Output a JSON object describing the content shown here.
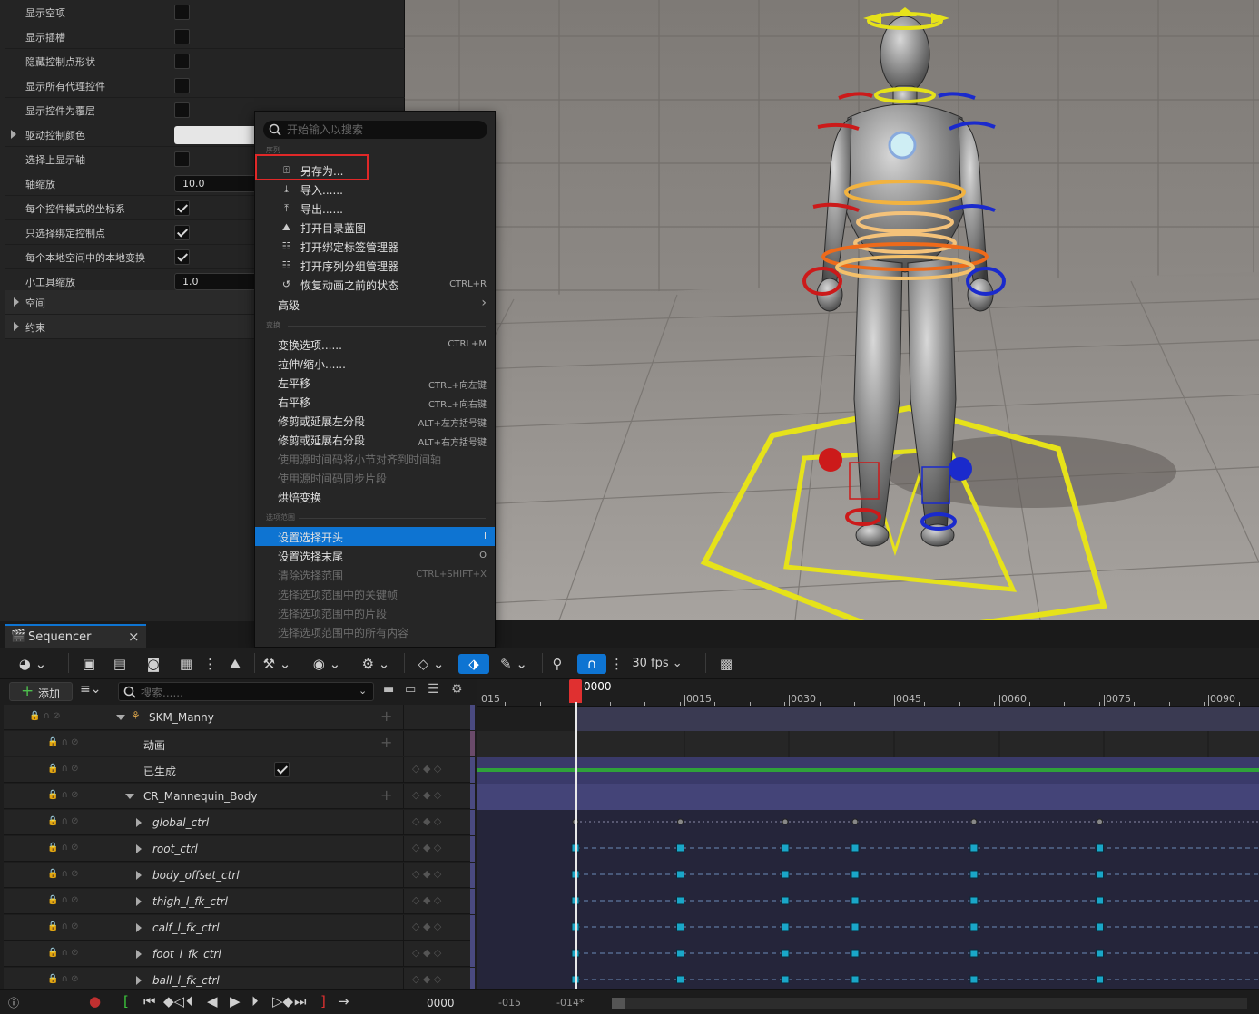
{
  "details": {
    "rows": [
      {
        "label": "显示空项",
        "type": "checkbox",
        "checked": false
      },
      {
        "label": "显示插槽",
        "type": "checkbox",
        "checked": false
      },
      {
        "label": "隐藏控制点形状",
        "type": "checkbox",
        "checked": false
      },
      {
        "label": "显示所有代理控件",
        "type": "checkbox",
        "checked": false
      },
      {
        "label": "显示控件为覆层",
        "type": "checkbox",
        "checked": false
      },
      {
        "label": "驱动控制颜色",
        "type": "color",
        "expandable": true
      },
      {
        "label": "选择上显示轴",
        "type": "checkbox",
        "checked": false
      },
      {
        "label": "轴缩放",
        "type": "number",
        "value": "10.0"
      },
      {
        "label": "每个控件模式的坐标系",
        "type": "checkbox",
        "checked": true
      },
      {
        "label": "只选择绑定控制点",
        "type": "checkbox",
        "checked": true
      },
      {
        "label": "每个本地空间中的本地变换",
        "type": "checkbox",
        "checked": true
      },
      {
        "label": "小工具缩放",
        "type": "number",
        "value": "1.0"
      }
    ],
    "categories": [
      "空间",
      "约束"
    ]
  },
  "menu": {
    "search_placeholder": "开始输入以搜索",
    "sections": {
      "sequence": "序列",
      "transform": "变换",
      "selection_range": "选项范围"
    },
    "items": [
      {
        "label": "另存为...",
        "shortcut": "",
        "icon": "save-as-icon",
        "highlighted_box": true
      },
      {
        "label": "导入......",
        "shortcut": "",
        "icon": "import-icon"
      },
      {
        "label": "导出......",
        "shortcut": "",
        "icon": "export-icon"
      },
      {
        "label": "打开目录蓝图",
        "shortcut": "",
        "icon": "blueprint-icon"
      },
      {
        "label": "打开绑定标签管理器",
        "shortcut": "",
        "icon": "list-icon"
      },
      {
        "label": "打开序列分组管理器",
        "shortcut": "",
        "icon": "list-icon"
      },
      {
        "label": "恢复动画之前的状态",
        "shortcut": "CTRL+R",
        "icon": "restore-icon"
      },
      {
        "label": "高级",
        "shortcut": "",
        "submenu": true
      },
      {
        "label": "变换选项......",
        "shortcut": "CTRL+M"
      },
      {
        "label": "拉伸/缩小......",
        "shortcut": ""
      },
      {
        "label": "左平移",
        "shortcut": "CTRL+向左键"
      },
      {
        "label": "右平移",
        "shortcut": "CTRL+向右键"
      },
      {
        "label": "修剪或延展左分段",
        "shortcut": "ALT+左方括号键"
      },
      {
        "label": "修剪或延展右分段",
        "shortcut": "ALT+右方括号键"
      },
      {
        "label": "使用源时间码将小节对齐到时间轴",
        "shortcut": "",
        "disabled": true
      },
      {
        "label": "使用源时间码同步片段",
        "shortcut": "",
        "disabled": true
      },
      {
        "label": "烘焙变换",
        "shortcut": ""
      },
      {
        "label": "设置选择开头",
        "shortcut": "I",
        "selected": true
      },
      {
        "label": "设置选择末尾",
        "shortcut": "O"
      },
      {
        "label": "清除选择范围",
        "shortcut": "CTRL+SHIFT+X",
        "disabled": true
      },
      {
        "label": "选择选项范围中的关键帧",
        "shortcut": "",
        "disabled": true
      },
      {
        "label": "选择选项范围中的片段",
        "shortcut": "",
        "disabled": true
      },
      {
        "label": "选择选项范围中的所有内容",
        "shortcut": "",
        "disabled": true
      }
    ]
  },
  "sequencer": {
    "tab_title": "Sequencer",
    "close": "×",
    "add_label": "添加",
    "search_placeholder": "搜索......",
    "fps": "30 fps",
    "tracks": [
      {
        "name": "SKM_Manny",
        "level": 0,
        "expanded": true
      },
      {
        "name": "动画",
        "level": 1
      },
      {
        "name": "已生成",
        "level": 1,
        "checkbox": true
      },
      {
        "name": "CR_Mannequin_Body",
        "level": 1,
        "expanded": true
      },
      {
        "name": "global_ctrl",
        "level": 2
      },
      {
        "name": "root_ctrl",
        "level": 2
      },
      {
        "name": "body_offset_ctrl",
        "level": 2
      },
      {
        "name": "thigh_l_fk_ctrl",
        "level": 2
      },
      {
        "name": "calf_l_fk_ctrl",
        "level": 2
      },
      {
        "name": "foot_l_fk_ctrl",
        "level": 2
      },
      {
        "name": "ball_l_fk_ctrl",
        "level": 2
      }
    ],
    "ruler": {
      "current": "0000",
      "labels": [
        "015",
        "0015",
        "0030",
        "0045",
        "0060",
        "0075",
        "0090"
      ]
    },
    "keyframes": [
      0,
      15,
      30,
      40,
      57,
      75
    ],
    "playback": {
      "time": "0000",
      "start": "-015",
      "end": "-014*"
    }
  },
  "colors": {
    "accent": "#0e74d2",
    "playhead": "#e03030",
    "key": "#1aa7c8"
  }
}
